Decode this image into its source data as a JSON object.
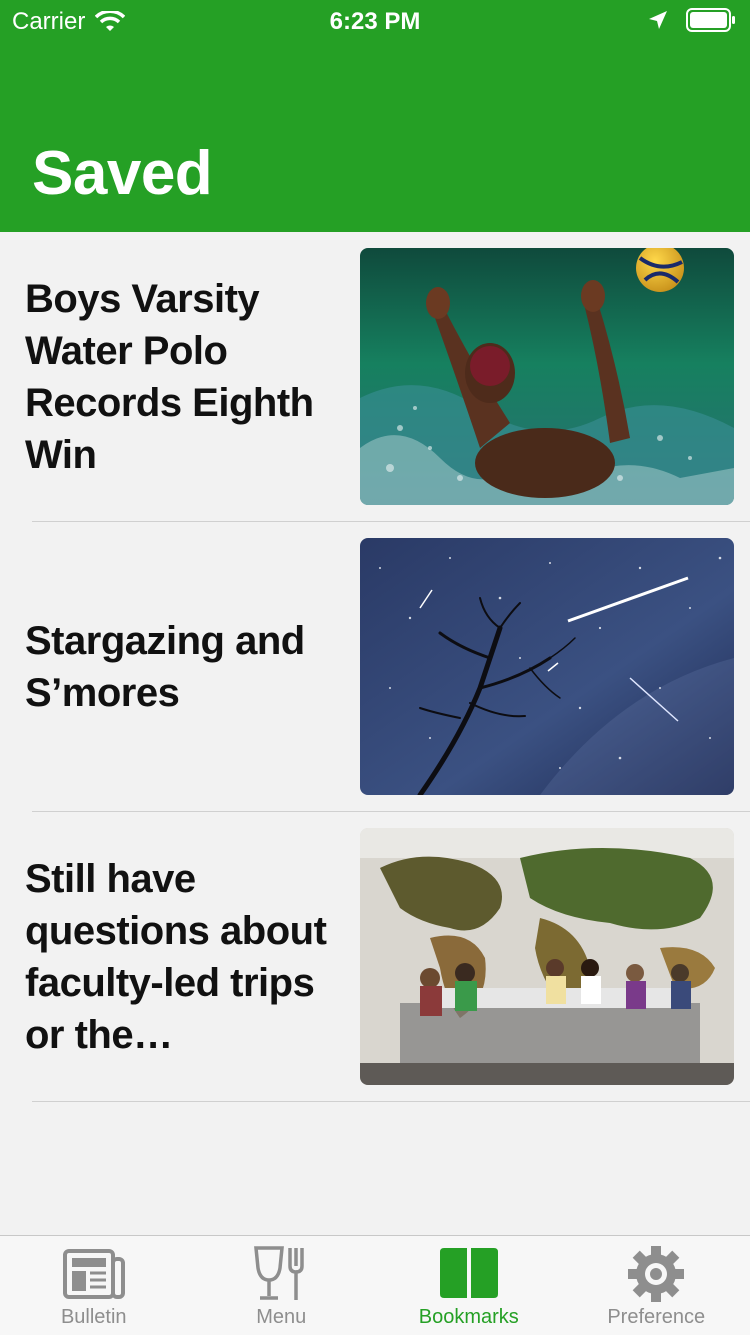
{
  "status_bar": {
    "carrier": "Carrier",
    "time": "6:23 PM"
  },
  "header": {
    "title": "Saved",
    "color": "#25a025"
  },
  "articles": [
    {
      "title": "Boys Varsity Water Polo Records Eighth Win",
      "image": "water-polo-photo"
    },
    {
      "title": "Stargazing and S’mores",
      "image": "night-sky-photo"
    },
    {
      "title": "Still have questions about faculty-led trips or the application process?",
      "image": "classroom-world-map-photo"
    }
  ],
  "tabs": [
    {
      "label": "Bulletin",
      "icon": "newspaper-icon",
      "active": false
    },
    {
      "label": "Menu",
      "icon": "fork-glass-icon",
      "active": false
    },
    {
      "label": "Bookmarks",
      "icon": "book-icon",
      "active": true
    },
    {
      "label": "Preference",
      "icon": "gear-icon",
      "active": false
    }
  ],
  "colors": {
    "accent": "#25a025",
    "inactive": "#8e8e8e"
  }
}
